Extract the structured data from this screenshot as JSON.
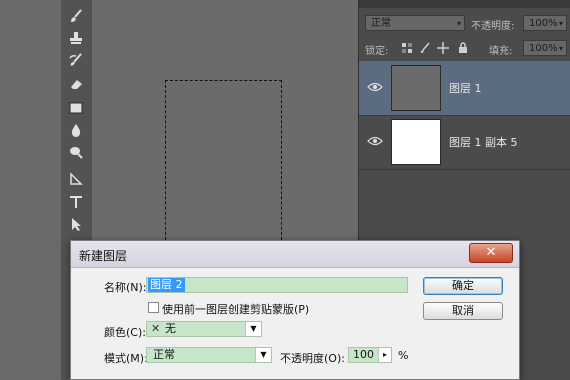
{
  "colors": {
    "workspace": "#6b6b6b",
    "panel": "#4b4b4b",
    "selected_layer": "#5b6b80",
    "dialog_bg": "#f0f0f0",
    "field_green": "#c7e6c9",
    "selection_blue": "#3399ff",
    "close_red": "#c8442a"
  },
  "toolbar": {
    "tools": [
      {
        "icon": "brush-icon"
      },
      {
        "icon": "clone-stamp-icon"
      },
      {
        "icon": "history-brush-icon"
      },
      {
        "icon": "eraser-icon"
      },
      {
        "icon": "gradient-icon"
      },
      {
        "icon": "blur-icon"
      },
      {
        "icon": "dodge-icon"
      },
      {
        "icon": "path-selection-icon"
      },
      {
        "icon": "type-icon"
      },
      {
        "icon": "direct-selection-icon"
      }
    ]
  },
  "layers_panel": {
    "blend_mode": "正常",
    "opacity_label": "不透明度:",
    "opacity_value": "100%",
    "lock_label": "锁定:",
    "fill_label": "填充:",
    "fill_value": "100%",
    "layers": [
      {
        "name": "图层 1",
        "selected": true,
        "thumb_color": "#6b6b6b"
      },
      {
        "name": "图层 1 副本 5",
        "selected": false,
        "thumb_color": "#ffffff"
      }
    ]
  },
  "dialog": {
    "title": "新建图层",
    "close_label": "✕",
    "name_label": "名称(N):",
    "name_value": "图层 2",
    "clip_checkbox_label": "使用前一图层创建剪贴蒙版(P)",
    "clip_checked": false,
    "color_label": "颜色(C):",
    "color_value": "无",
    "mode_label": "模式(M):",
    "mode_value": "正常",
    "opacity_label": "不透明度(O):",
    "opacity_value": "100",
    "opacity_unit": "%",
    "ok_label": "确定",
    "cancel_label": "取消"
  }
}
